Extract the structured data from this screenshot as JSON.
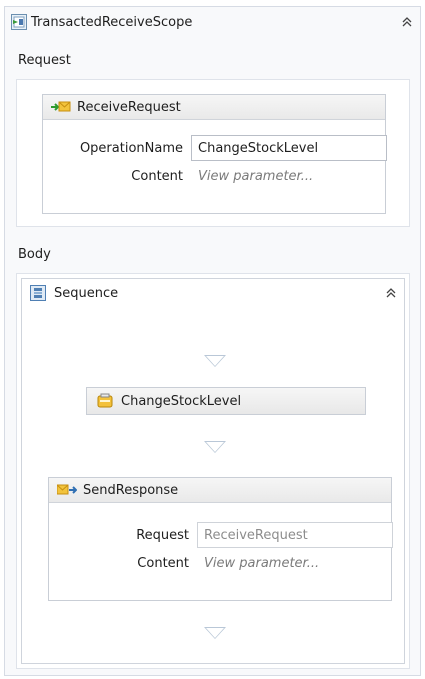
{
  "scope": {
    "title": "TransactedReceiveScope",
    "request_label": "Request",
    "body_label": "Body"
  },
  "receive": {
    "title": "ReceiveRequest",
    "operation_label": "OperationName",
    "operation_value": "ChangeStockLevel",
    "content_label": "Content",
    "content_link": "View parameter..."
  },
  "sequence": {
    "title": "Sequence",
    "activity_title": "ChangeStockLevel"
  },
  "send": {
    "title": "SendResponse",
    "request_label": "Request",
    "request_value": "ReceiveRequest",
    "content_label": "Content",
    "content_link": "View parameter..."
  }
}
